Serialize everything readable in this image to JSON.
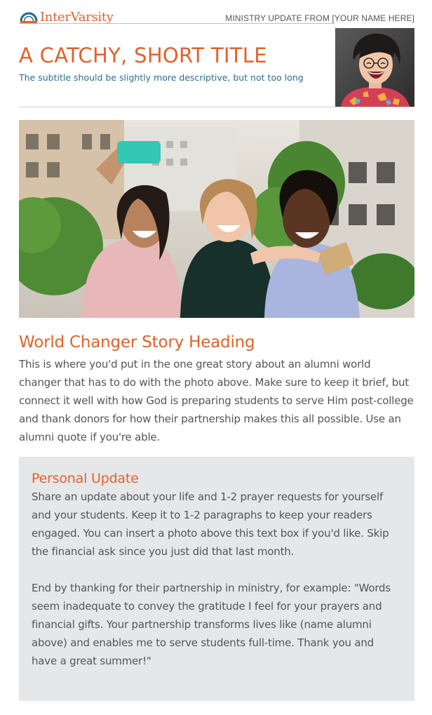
{
  "brand": {
    "name": "InterVarsity",
    "accent": "#e0622d",
    "subtitle_color": "#2b6e8f",
    "text_color": "#555555"
  },
  "header": {
    "right_text": "MINISTRY UPDATE FROM [YOUR NAME HERE]"
  },
  "title": "A CATCHY, SHORT TITLE",
  "subtitle": "The subtitle should be slightly more descriptive, but not too long",
  "story": {
    "heading": "World Changer Story Heading",
    "body": "This is where you'd put in the one great story about an alumni world changer that has to do with the photo above. Make sure to keep it brief, but connect it well with how God is preparing students to serve Him post-college and thank donors for how their partnership makes this all possible. Use an alumni quote if you're able."
  },
  "personal_update": {
    "heading": "Personal Update",
    "paragraph_1": "Share an update about your life and 1-2 prayer requests for yourself and your students. Keep it to 1-2 paragraphs to keep your readers engaged. You can insert a photo above this text box if you'd like. Skip the financial ask since you just did that last month.",
    "paragraph_2": "End by thanking for their partnership in ministry, for example: \"Words seem inadequate to convey the gratitude I feel for your prayers and financial gifts. Your partnership transforms lives like (name alumni above) and enables me to serve students full-time. Thank you and have a great summer!\"",
    "background": "#e6e7e9"
  },
  "icons": {
    "logo": "intervarsity-arch-logo",
    "avatar": "smiling-woman-portrait",
    "hero": "three-students-selfie-photo"
  }
}
